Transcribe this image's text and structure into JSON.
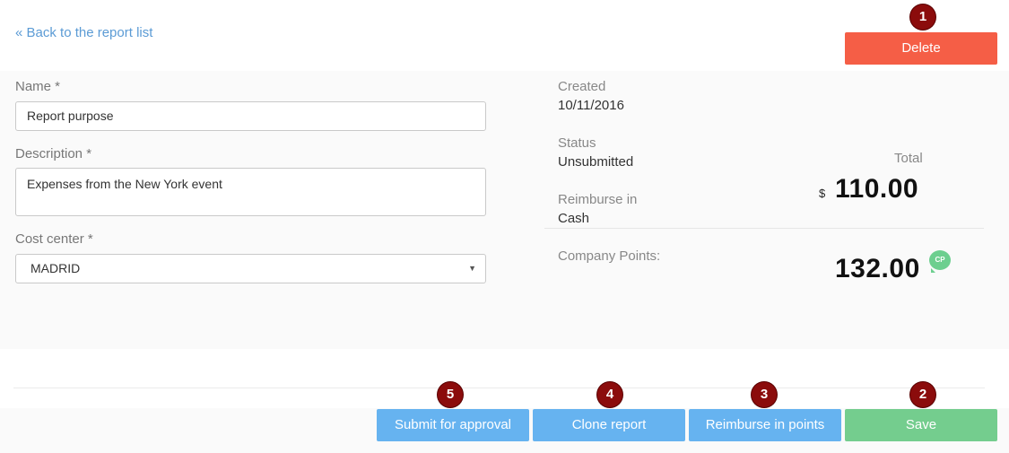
{
  "nav": {
    "back_link": "« Back to the report list"
  },
  "form": {
    "name_label": "Name *",
    "name_value": "Report purpose",
    "description_label": "Description *",
    "description_value": "Expenses from the New York event",
    "cost_center_label": "Cost center *",
    "cost_center_value": "MADRID"
  },
  "info": {
    "created_label": "Created",
    "created_value": "10/11/2016",
    "status_label": "Status",
    "status_value": "Unsubmitted",
    "reimburse_label": "Reimburse in",
    "reimburse_value": "Cash",
    "total_label": "Total",
    "currency": "$",
    "total_amount": "110.00",
    "points_label": "Company Points:",
    "points_amount": "132.00",
    "points_badge": "CP"
  },
  "actions": {
    "delete_label": "Delete",
    "submit_label": "Submit for approval",
    "clone_label": "Clone report",
    "reimburse_points_label": "Reimburse in points",
    "save_label": "Save"
  },
  "markers": {
    "delete": "1",
    "save": "2",
    "reimburse": "3",
    "clone": "4",
    "submit": "5"
  },
  "colors": {
    "link": "#5b9bd5",
    "delete": "#f55e46",
    "primary": "#66b3f0",
    "save": "#74cd8e",
    "marker": "#8b0c0c",
    "cp_badge": "#6dcf8f"
  }
}
